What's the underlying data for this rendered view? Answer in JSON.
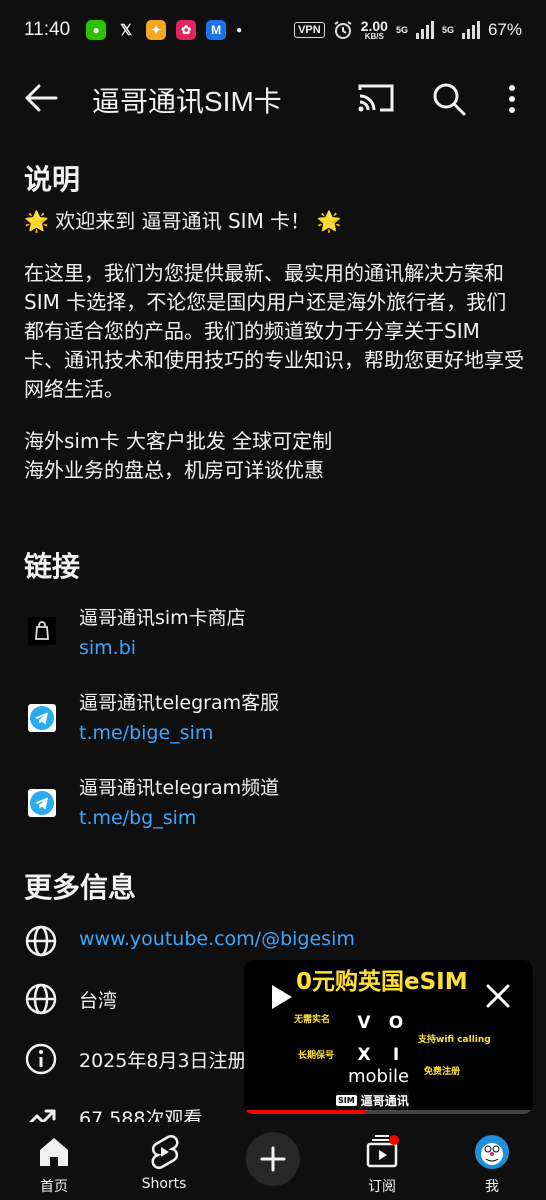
{
  "status_bar": {
    "time": "11:40",
    "vpn": "VPN",
    "speed_value": "2.00",
    "speed_unit": "KB/S",
    "network_1": "5G",
    "network_2": "5G",
    "battery": "67%"
  },
  "app_bar": {
    "title": "逼哥通讯SIM卡"
  },
  "description": {
    "heading": "说明",
    "welcome": "🌟 欢迎来到 逼哥通讯 SIM 卡！ 🌟",
    "body": "在这里，我们为您提供最新、最实用的通讯解决方案和 SIM 卡选择，不论您是国内用户还是海外旅行者，我们都有适合您的产品。我们的频道致力于分享关于SIM 卡、通讯技术和使用技巧的专业知识，帮助您更好地享受网络生活。",
    "line1": "海外sim卡 大客户批发 全球可定制",
    "line2": "海外业务的盘总，机房可详谈优惠"
  },
  "links": {
    "heading": "链接",
    "items": [
      {
        "title": "逼哥通讯sim卡商店",
        "url": "sim.bi",
        "icon": "shopping-bag-icon"
      },
      {
        "title": "逼哥通讯telegram客服",
        "url": "t.me/bige_sim",
        "icon": "telegram-icon"
      },
      {
        "title": "逼哥通讯telegram频道",
        "url": "t.me/bg_sim",
        "icon": "telegram-icon"
      }
    ]
  },
  "more_info": {
    "heading": "更多信息",
    "website": "www.youtube.com/@bigesim",
    "location": "台湾",
    "joined": "2025年8月3日注册",
    "views": "67,588次观看"
  },
  "mini_player": {
    "title_prefix": "0元购",
    "title_main": "英国eSIM",
    "tag_1": "无需实名",
    "tag_2": "长期保号",
    "tag_3": "支持wifi calling",
    "tag_4": "免费注册",
    "voxi_letters": [
      "V",
      "O",
      "X",
      "I"
    ],
    "mobile": "mobile",
    "brand_sim": "SIM",
    "brand": "逼哥通讯",
    "progress": 0.42,
    "colors": {
      "accent": "#ffe033",
      "progress": "#ff0000"
    }
  },
  "bottom_nav": {
    "home": "首页",
    "shorts": "Shorts",
    "subscriptions": "订阅",
    "me": "我"
  },
  "colors": {
    "background": "#0f0f0f",
    "link": "#3ea6ff",
    "text": "#f1f1f1"
  }
}
